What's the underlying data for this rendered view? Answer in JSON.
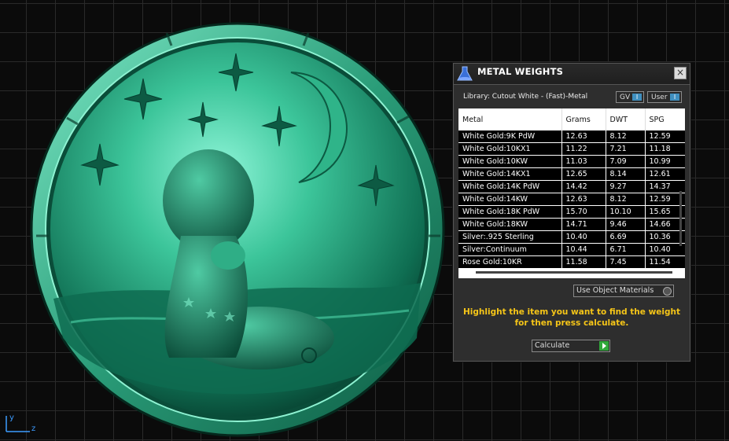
{
  "viewport": {
    "axis_labels": {
      "y": "y",
      "z": "z"
    }
  },
  "panel": {
    "title": "METAL WEIGHTS",
    "close_label": "×",
    "library_label": "Library: Cutout White - (Fast)-Metal",
    "gv_label": "GV",
    "user_label": "User",
    "toggle_knob": "I",
    "columns": [
      "Metal",
      "Grams",
      "DWT",
      "SPG"
    ],
    "rows": [
      [
        "White Gold:9K PdW",
        "12.63",
        "8.12",
        "12.59"
      ],
      [
        "White Gold:10KX1",
        "11.22",
        "7.21",
        "11.18"
      ],
      [
        "White Gold:10KW",
        "11.03",
        "7.09",
        "10.99"
      ],
      [
        "White Gold:14KX1",
        "12.65",
        "8.14",
        "12.61"
      ],
      [
        "White Gold:14K PdW",
        "14.42",
        "9.27",
        "14.37"
      ],
      [
        "White Gold:14KW",
        "12.63",
        "8.12",
        "12.59"
      ],
      [
        "White Gold:18K PdW",
        "15.70",
        "10.10",
        "15.65"
      ],
      [
        "White Gold:18KW",
        "14.71",
        "9.46",
        "14.66"
      ],
      [
        "Silver:.925 Sterling",
        "10.40",
        "6.69",
        "10.36"
      ],
      [
        "Silver:Continuum",
        "10.44",
        "6.71",
        "10.40"
      ],
      [
        "Rose Gold:10KR",
        "11.58",
        "7.45",
        "11.54"
      ]
    ],
    "use_object_materials_label": "Use Object Materials",
    "hint_text": "Highlight the item you want to find the weight for then press calculate.",
    "calculate_label": "Calculate"
  },
  "colors": {
    "hint": "#f5c518",
    "accent": "#3f8fbf",
    "model": "#1fa37a",
    "go": "#2fa83a"
  }
}
